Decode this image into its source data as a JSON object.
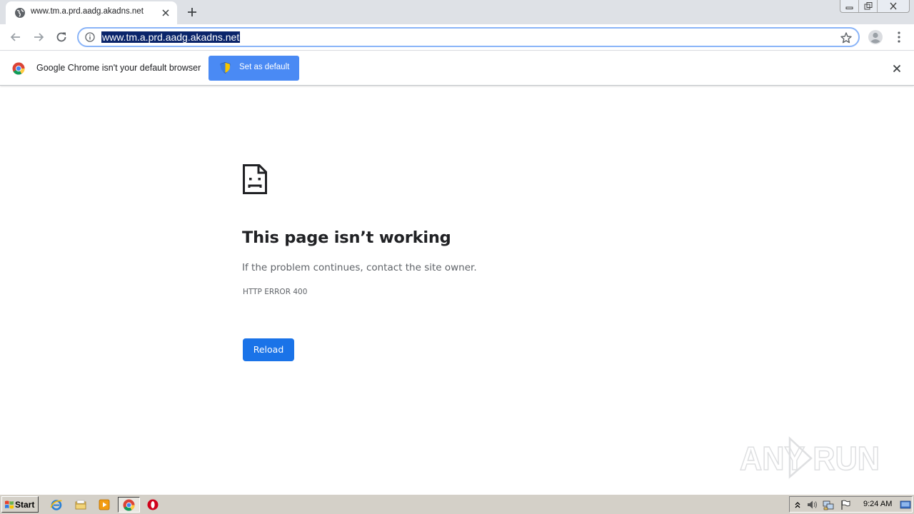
{
  "browser": {
    "tab": {
      "title": "www.tm.a.prd.aadg.akadns.net"
    },
    "omnibox": {
      "url": "www.tm.a.prd.aadg.akadns.net"
    }
  },
  "infobar": {
    "message": "Google Chrome isn't your default browser",
    "button_label": "Set as default"
  },
  "error_page": {
    "title": "This page isn’t working",
    "message": "If the problem continues, contact the site owner.",
    "code": "HTTP ERROR 400",
    "reload_label": "Reload"
  },
  "watermark": {
    "text": "ANY RUN"
  },
  "taskbar": {
    "start_label": "Start",
    "clock": "9:24 AM",
    "pinned": [
      "ie-icon",
      "explorer-icon",
      "media-player-icon",
      "chrome-icon",
      "opera-icon"
    ]
  },
  "colors": {
    "accent": "#1a73e8",
    "infobar_button": "#4a8af4",
    "url_selection": "#0a246a",
    "tab_strip": "#dee1e6",
    "taskbar": "#d4d0c8"
  }
}
